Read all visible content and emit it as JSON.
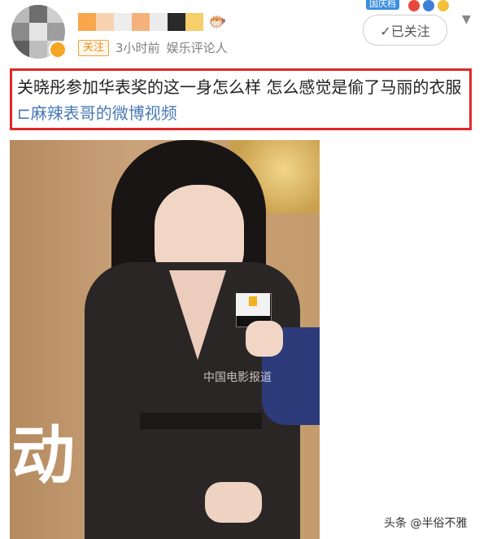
{
  "header": {
    "follow_status": "关注",
    "time_ago": "3小时前",
    "source": "娱乐评论人",
    "follow_button": "✓已关注",
    "holiday_badge": "国庆档"
  },
  "post": {
    "text": "关晓彤参加华表奖的这一身怎么样 怎么感觉是偷了马丽的衣服",
    "video_link": "麻辣表哥的微博视频"
  },
  "photo": {
    "background_char": "动",
    "watermark": "中国电影报道"
  },
  "footer": {
    "watermark": "头条 @半俗不雅"
  },
  "colors": {
    "accent_red": "#e02828",
    "link_blue": "#4a7ab8",
    "tag_orange": "#f08a1e"
  }
}
